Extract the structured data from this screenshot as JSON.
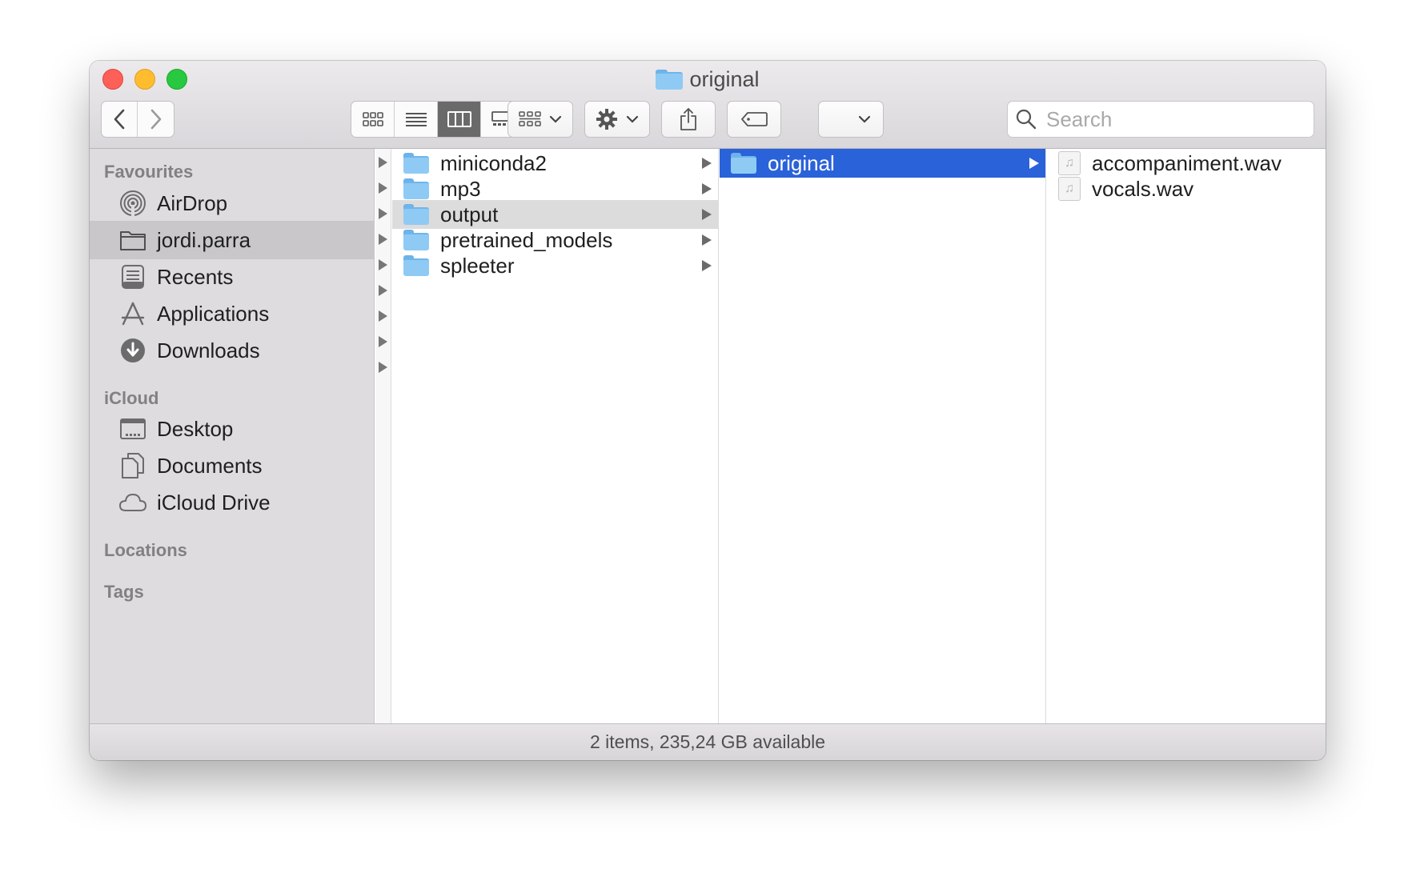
{
  "window": {
    "title": "original"
  },
  "toolbar": {
    "back_icon": "chevron-left-icon",
    "forward_icon": "chevron-right-icon",
    "view_modes": [
      "icon-view-icon",
      "list-view-icon",
      "column-view-icon",
      "gallery-view-icon"
    ],
    "active_view": "column-view-icon",
    "group_icon": "group-by-icon",
    "action_icon": "gear-icon",
    "share_icon": "share-icon",
    "tag_icon": "tag-icon",
    "search": {
      "placeholder": "Search",
      "value": ""
    }
  },
  "sidebar": {
    "favourites_label": "Favourites",
    "favourites": [
      {
        "label": "AirDrop",
        "icon": "airdrop-icon"
      },
      {
        "label": "jordi.parra",
        "icon": "home-folder-icon",
        "selected": true
      },
      {
        "label": "Recents",
        "icon": "recents-icon"
      },
      {
        "label": "Applications",
        "icon": "applications-icon"
      },
      {
        "label": "Downloads",
        "icon": "downloads-icon"
      }
    ],
    "icloud_label": "iCloud",
    "icloud": [
      {
        "label": "Desktop",
        "icon": "desktop-icon"
      },
      {
        "label": "Documents",
        "icon": "documents-icon"
      },
      {
        "label": "iCloud Drive",
        "icon": "cloud-icon"
      }
    ],
    "locations_label": "Locations",
    "tags_label": "Tags"
  },
  "columns": {
    "col1": [
      {
        "name": "miniconda2"
      },
      {
        "name": "mp3"
      },
      {
        "name": "output",
        "highlighted": true
      },
      {
        "name": "pretrained_models"
      },
      {
        "name": "spleeter"
      }
    ],
    "col2": [
      {
        "name": "original",
        "selected": true
      }
    ],
    "col3": [
      {
        "name": "accompaniment.wav"
      },
      {
        "name": "vocals.wav"
      }
    ]
  },
  "status": {
    "text": "2 items, 235,24 GB available"
  },
  "colors": {
    "selection": "#2a62d9",
    "folder": "#8fcaf5",
    "sidebar_bg": "#dedcdf"
  }
}
